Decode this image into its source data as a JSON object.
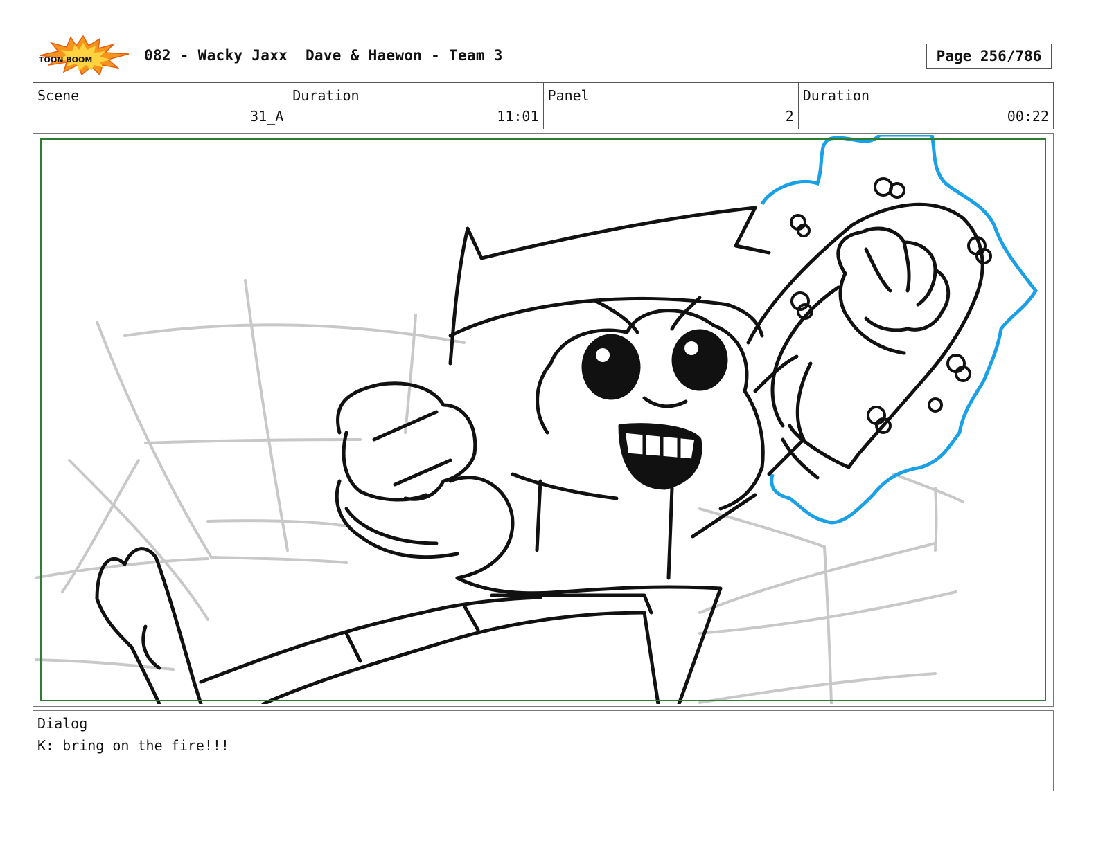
{
  "header": {
    "logo_text": "TOON BOOM",
    "title": "082 - Wacky Jaxx  Dave & Haewon - Team 3",
    "page": "Page 256/786"
  },
  "info": {
    "scene_label": "Scene",
    "scene_value": "31_A",
    "scene_duration_label": "Duration",
    "scene_duration_value": "11:01",
    "panel_label": "Panel",
    "panel_value": "2",
    "panel_duration_label": "Duration",
    "panel_duration_value": "00:22"
  },
  "frame": {
    "safe_area_color": "#2e7d32",
    "glow_color": "#1aa0e6"
  },
  "dialog": {
    "label": "Dialog",
    "text": "K: bring on the fire!!!"
  }
}
